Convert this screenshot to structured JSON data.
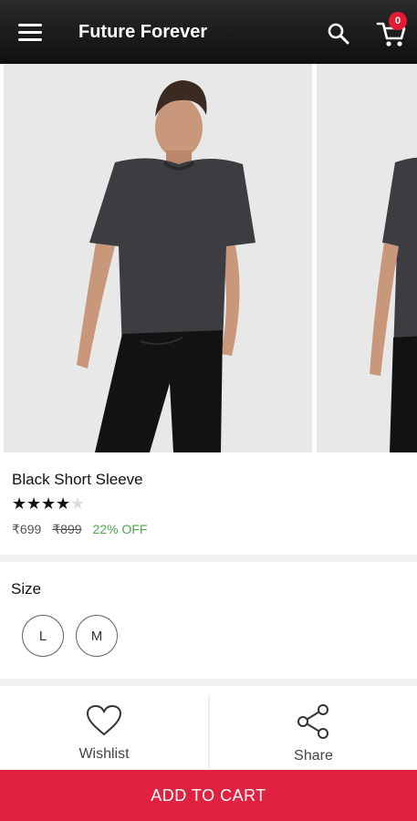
{
  "header": {
    "title": "Future Forever",
    "cart_count": "0",
    "menu_icon": "hamburger-icon",
    "search_icon": "search-icon",
    "cart_icon": "cart-icon"
  },
  "gallery": {
    "images": [
      "product-photo-front",
      "product-photo-side"
    ]
  },
  "product": {
    "name": "Black Short Sleeve",
    "rating": 4,
    "rating_max": 5,
    "price": "₹699",
    "original_price": "₹899",
    "discount": "22% OFF"
  },
  "size": {
    "label": "Size",
    "options": [
      "L",
      "M"
    ]
  },
  "actions": {
    "wishlist_label": "Wishlist",
    "share_label": "Share"
  },
  "cta": {
    "add_to_cart": "ADD TO CART"
  },
  "colors": {
    "header_bg": "#111111",
    "accent": "#e0213f",
    "discount": "#4ca64c"
  }
}
